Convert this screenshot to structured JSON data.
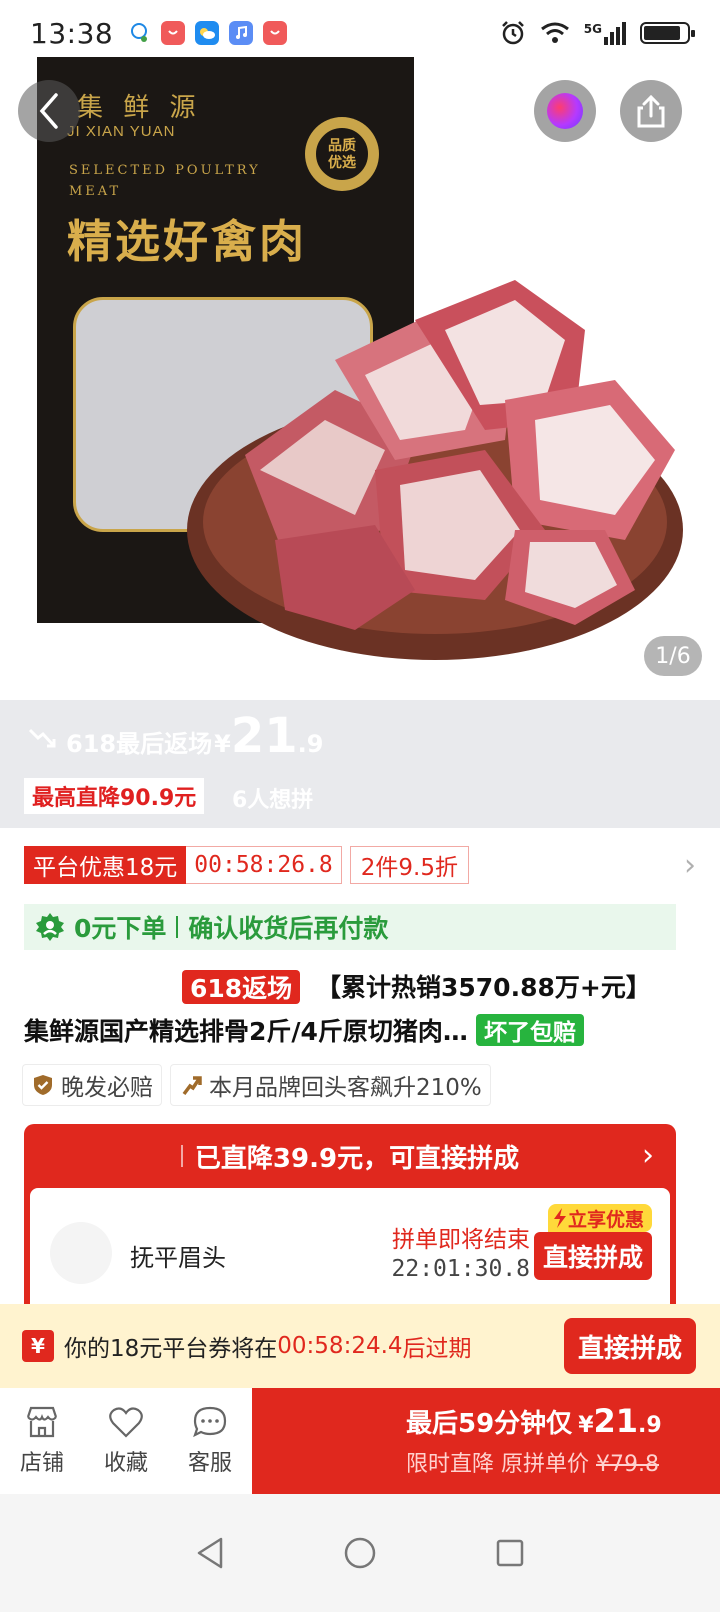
{
  "status_bar": {
    "time": "13:38",
    "network": "5G",
    "icons": [
      "qq-icon",
      "app-red-icon",
      "weather-icon",
      "music-icon",
      "app-red-icon",
      "alarm-icon",
      "wifi-icon",
      "signal-icon",
      "battery-icon"
    ]
  },
  "gallery": {
    "page_indicator": "1/6",
    "package": {
      "brand_cn": "集 鲜 源",
      "brand_en": "JI XIAN YUAN",
      "tagline_line1": "SELECTED POULTRY",
      "tagline_line2": "MEAT",
      "headline": "精选好禽肉",
      "badge_line1": "品质",
      "badge_line2": "优选"
    }
  },
  "price_band": {
    "label": "618最后返场",
    "currency": "¥",
    "price_int": "21",
    "price_dec": ".9",
    "max_discount": "最高直降90.9元",
    "wants": "6人想拼"
  },
  "coupons": {
    "platform": "平台优惠18元",
    "timer": "00:58:26.8",
    "multi_buy": "2件9.5折"
  },
  "pay_later": {
    "left": "0元下单",
    "right": "确认收货后再付款"
  },
  "title": {
    "tag_618": "618返场",
    "hot_sales": "【累计热销3570.88万+元】",
    "product": "集鲜源国产精选排骨2斤/4斤原切猪肉…",
    "broken_tag": "坏了包赔"
  },
  "services": [
    {
      "icon": "shield-check-icon",
      "label": "晚发必赔"
    },
    {
      "icon": "trend-up-icon",
      "label": "本月品牌回头客飙升210%"
    }
  ],
  "group_buy": {
    "header": "已直降39.9元，可直接拼成",
    "user": "抚平眉头",
    "ending_label": "拼单即将结束",
    "countdown": "22:01:30.8",
    "instant_tag": "立享优惠",
    "join_button": "直接拼成"
  },
  "expire_banner": {
    "text_before": "你的18元平台券将在",
    "time": "00:58:24.4",
    "text_after": "后过期",
    "button": "直接拼成"
  },
  "action_bar": {
    "shop": "店铺",
    "favorite": "收藏",
    "service": "客服",
    "buy_line1": "最后59分钟仅",
    "buy_currency": "¥",
    "buy_int": "21",
    "buy_dec": ".9",
    "buy_line2_prefix": "限时直降 原拼单价",
    "original_price": "¥79.8"
  },
  "colors": {
    "brand_red": "#e0281e",
    "green": "#27b43e",
    "gold": "#c9a54a"
  }
}
